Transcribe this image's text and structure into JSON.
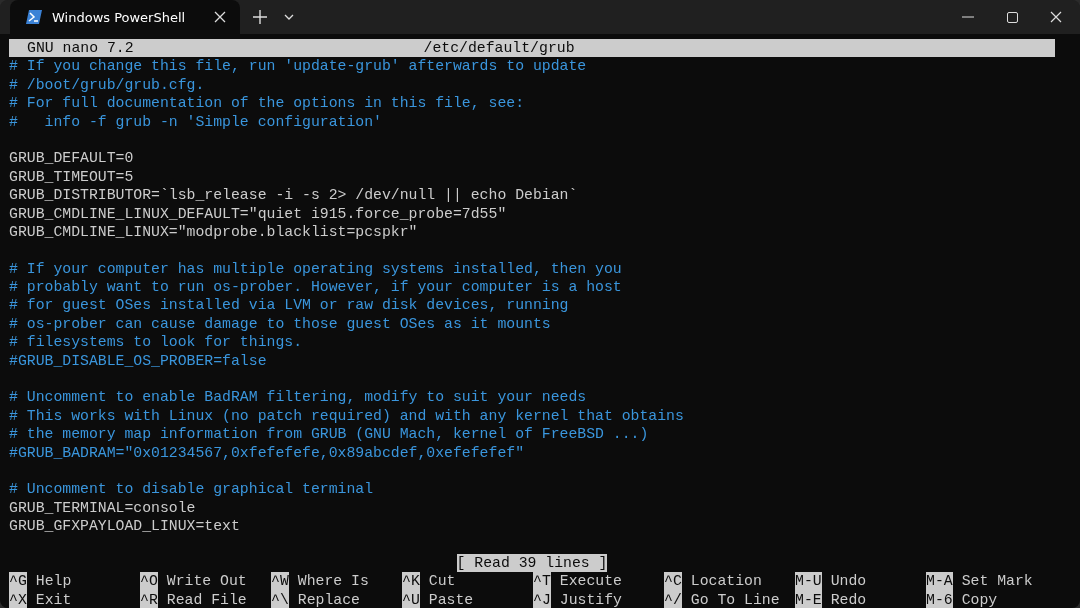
{
  "window": {
    "tabs": [
      {
        "title": "Windows PowerShell",
        "selected": true
      }
    ]
  },
  "nano": {
    "version": "GNU nano 7.2",
    "filename": "/etc/default/grub",
    "lines": [
      {
        "kind": "comment",
        "text": "# If you change this file, run 'update-grub' afterwards to update"
      },
      {
        "kind": "comment",
        "text": "# /boot/grub/grub.cfg."
      },
      {
        "kind": "comment",
        "text": "# For full documentation of the options in this file, see:"
      },
      {
        "kind": "comment",
        "text": "#   info -f grub -n 'Simple configuration'"
      },
      {
        "kind": "blank"
      },
      {
        "kind": "code",
        "text": "GRUB_DEFAULT=0"
      },
      {
        "kind": "code",
        "text": "GRUB_TIMEOUT=5"
      },
      {
        "kind": "code",
        "text": "GRUB_DISTRIBUTOR=`lsb_release -i -s 2> /dev/null || echo Debian`"
      },
      {
        "kind": "code",
        "text": "GRUB_CMDLINE_LINUX_DEFAULT=\"quiet i915.force_probe=7d55\""
      },
      {
        "kind": "code",
        "text": "GRUB_CMDLINE_LINUX=\"modprobe.blacklist=pcspkr\""
      },
      {
        "kind": "blank"
      },
      {
        "kind": "comment",
        "text": "# If your computer has multiple operating systems installed, then you"
      },
      {
        "kind": "comment",
        "text": "# probably want to run os-prober. However, if your computer is a host"
      },
      {
        "kind": "comment",
        "text": "# for guest OSes installed via LVM or raw disk devices, running"
      },
      {
        "kind": "comment",
        "text": "# os-prober can cause damage to those guest OSes as it mounts"
      },
      {
        "kind": "comment",
        "text": "# filesystems to look for things."
      },
      {
        "kind": "comment",
        "text": "#GRUB_DISABLE_OS_PROBER=false"
      },
      {
        "kind": "blank"
      },
      {
        "kind": "comment",
        "text": "# Uncomment to enable BadRAM filtering, modify to suit your needs"
      },
      {
        "kind": "comment",
        "text": "# This works with Linux (no patch required) and with any kernel that obtains"
      },
      {
        "kind": "comment",
        "text": "# the memory map information from GRUB (GNU Mach, kernel of FreeBSD ...)"
      },
      {
        "kind": "comment",
        "text": "#GRUB_BADRAM=\"0x01234567,0xfefefefe,0x89abcdef,0xefefefef\""
      },
      {
        "kind": "blank"
      },
      {
        "kind": "comment",
        "text": "# Uncomment to disable graphical terminal"
      },
      {
        "kind": "code",
        "text": "GRUB_TERMINAL=console"
      },
      {
        "kind": "code",
        "text": "GRUB_GFXPAYLOAD_LINUX=text"
      },
      {
        "kind": "blank"
      }
    ],
    "status": "[ Read 39 lines ]",
    "shortcuts": [
      [
        {
          "key": "^G",
          "label": "Help"
        },
        {
          "key": "^X",
          "label": "Exit"
        }
      ],
      [
        {
          "key": "^O",
          "label": "Write Out"
        },
        {
          "key": "^R",
          "label": "Read File"
        }
      ],
      [
        {
          "key": "^W",
          "label": "Where Is"
        },
        {
          "key": "^\\",
          "label": "Replace"
        }
      ],
      [
        {
          "key": "^K",
          "label": "Cut"
        },
        {
          "key": "^U",
          "label": "Paste"
        }
      ],
      [
        {
          "key": "^T",
          "label": "Execute"
        },
        {
          "key": "^J",
          "label": "Justify"
        }
      ],
      [
        {
          "key": "^C",
          "label": "Location"
        },
        {
          "key": "^/",
          "label": "Go To Line"
        }
      ],
      [
        {
          "key": "M-U",
          "label": "Undo"
        },
        {
          "key": "M-E",
          "label": "Redo"
        }
      ],
      [
        {
          "key": "M-A",
          "label": "Set Mark"
        },
        {
          "key": "M-6",
          "label": "Copy"
        }
      ]
    ]
  }
}
